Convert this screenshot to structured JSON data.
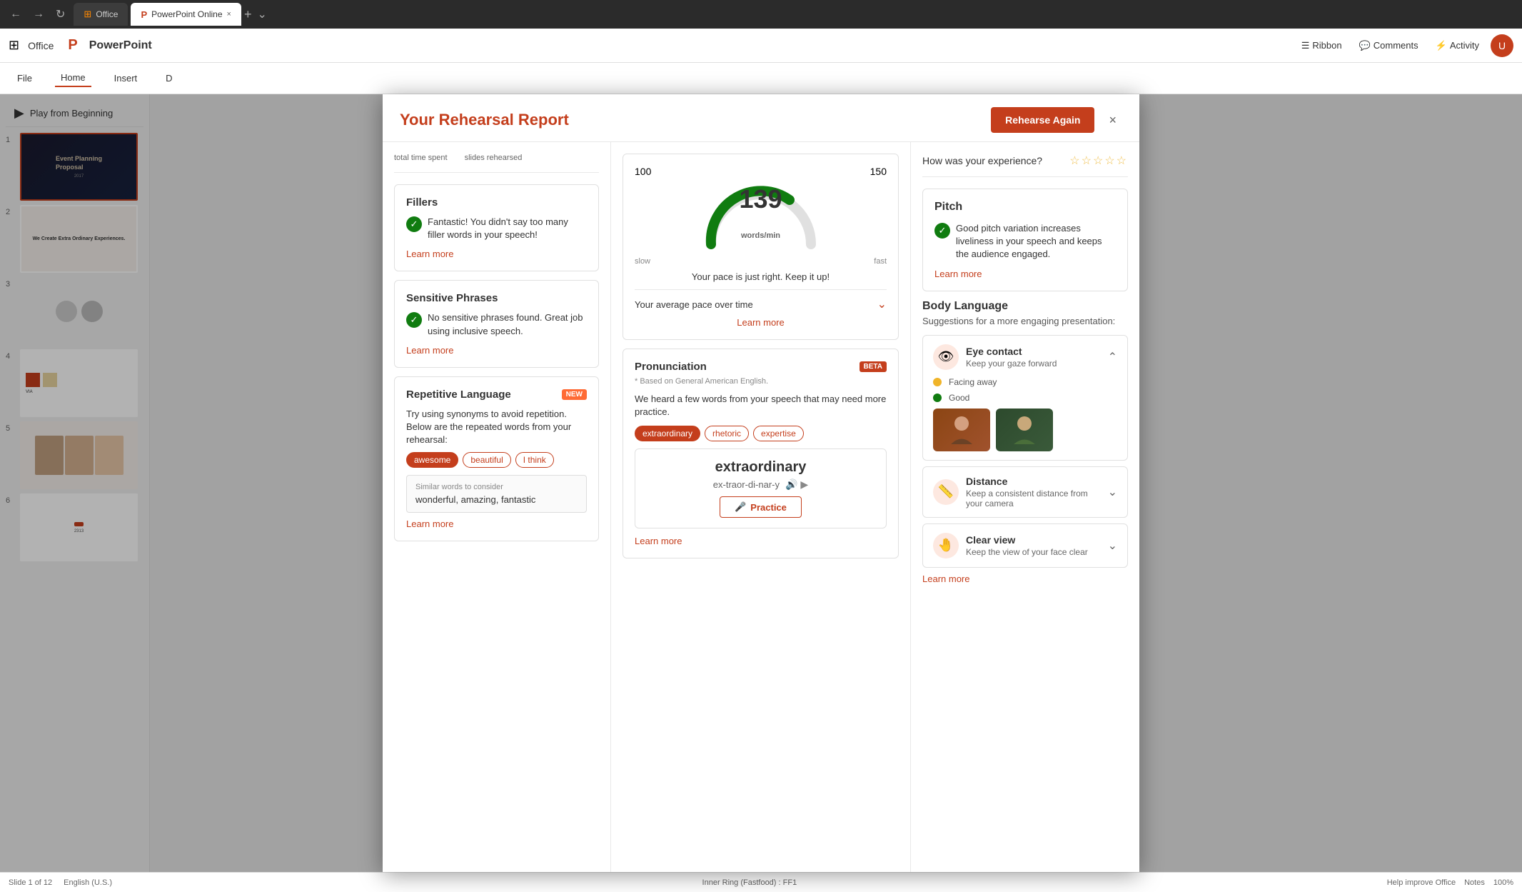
{
  "browser": {
    "tab_inactive": "Office",
    "tab_active_label": "PowerPoint Online",
    "tab_close": "×",
    "new_tab": "+",
    "more": "⌄"
  },
  "appbar": {
    "office_label": "Office",
    "pp_label": "PowerPoint",
    "ribbon_items": [
      "File",
      "Home",
      "Insert",
      "D"
    ],
    "ribbon_label": "Ribbon",
    "comments_label": "Comments",
    "activity_label": "Activity"
  },
  "sidebar": {
    "play_from_beginning": "Play from Beginning",
    "slides": [
      {
        "num": "1",
        "title": "Event Planning Proposal",
        "selected": true
      },
      {
        "num": "2",
        "title": "We Create Extra Ordinary Experiences.",
        "selected": false
      },
      {
        "num": "3",
        "title": "",
        "selected": false
      },
      {
        "num": "4",
        "title": "",
        "selected": false
      },
      {
        "num": "5",
        "title": "",
        "selected": false
      },
      {
        "num": "6",
        "title": "",
        "selected": false
      }
    ]
  },
  "modal": {
    "title": "Your Rehearsal Report",
    "rehearse_again": "Rehearse Again",
    "close": "×",
    "summary": {
      "total_time_label": "total time spent",
      "slides_rehearsed_label": "slides rehearsed"
    },
    "fillers": {
      "title": "Fillers",
      "text": "Fantastic! You didn't say too many filler words in your speech!",
      "learn_more": "Learn more"
    },
    "sensitive_phrases": {
      "title": "Sensitive Phrases",
      "text": "No sensitive phrases found. Great job using inclusive speech.",
      "learn_more": "Learn more"
    },
    "repetitive": {
      "title": "Repetitive Language",
      "badge": "NEW",
      "desc": "Try using synonyms to avoid repetition. Below are the repeated words from your rehearsal:",
      "tags": [
        "awesome",
        "beautiful",
        "I think"
      ],
      "similar_label": "Similar words to consider",
      "similar_words": "wonderful, amazing, fantastic",
      "learn_more": "Learn more"
    },
    "pace": {
      "value": "139",
      "unit": "words/min",
      "slow_label": "slow",
      "fast_label": "fast",
      "label_100": "100",
      "label_150": "150",
      "pace_text": "Your pace is just right. Keep it up!",
      "over_time_label": "Your average pace over time",
      "learn_more": "Learn more"
    },
    "pronunciation": {
      "title": "Pronunciation",
      "badge": "BETA",
      "sub": "* Based on General American English.",
      "desc": "We heard a few words from your speech that may need more practice.",
      "tags": [
        "extraordinary",
        "rhetoric",
        "expertise"
      ],
      "word_main": "extraordinary",
      "word_phonetic": "ex-traor-di-nar-y",
      "practice_btn": "Practice",
      "learn_more": "Learn more"
    },
    "experience": {
      "label": "How was your experience?",
      "stars": "☆☆☆☆☆"
    },
    "pitch": {
      "title": "Pitch",
      "text": "Good pitch variation increases liveliness in your speech and keeps the audience engaged.",
      "learn_more": "Learn more"
    },
    "body_language": {
      "title": "Body Language",
      "sub": "Suggestions for a more engaging presentation:",
      "items": [
        {
          "name": "Eye contact",
          "desc": "Keep your gaze forward",
          "icon": "👁",
          "expanded": true,
          "status1_label": "Facing away",
          "status2_label": "Good",
          "image1_label": "Facing",
          "image2_label": "Good"
        },
        {
          "name": "Distance",
          "desc": "Keep a consistent distance from your camera",
          "icon": "📏",
          "expanded": false
        },
        {
          "name": "Clear view",
          "desc": "Keep the view of your face clear",
          "icon": "🤚",
          "expanded": false
        }
      ],
      "learn_more": "Learn more"
    }
  },
  "statusbar": {
    "slide_info": "Slide 1 of 12",
    "language": "English (U.S.)",
    "inner_ring": "Inner Ring (Fastfood) : FF1",
    "help_improve": "Help improve Office",
    "notes": "Notes",
    "zoom": "100%"
  }
}
